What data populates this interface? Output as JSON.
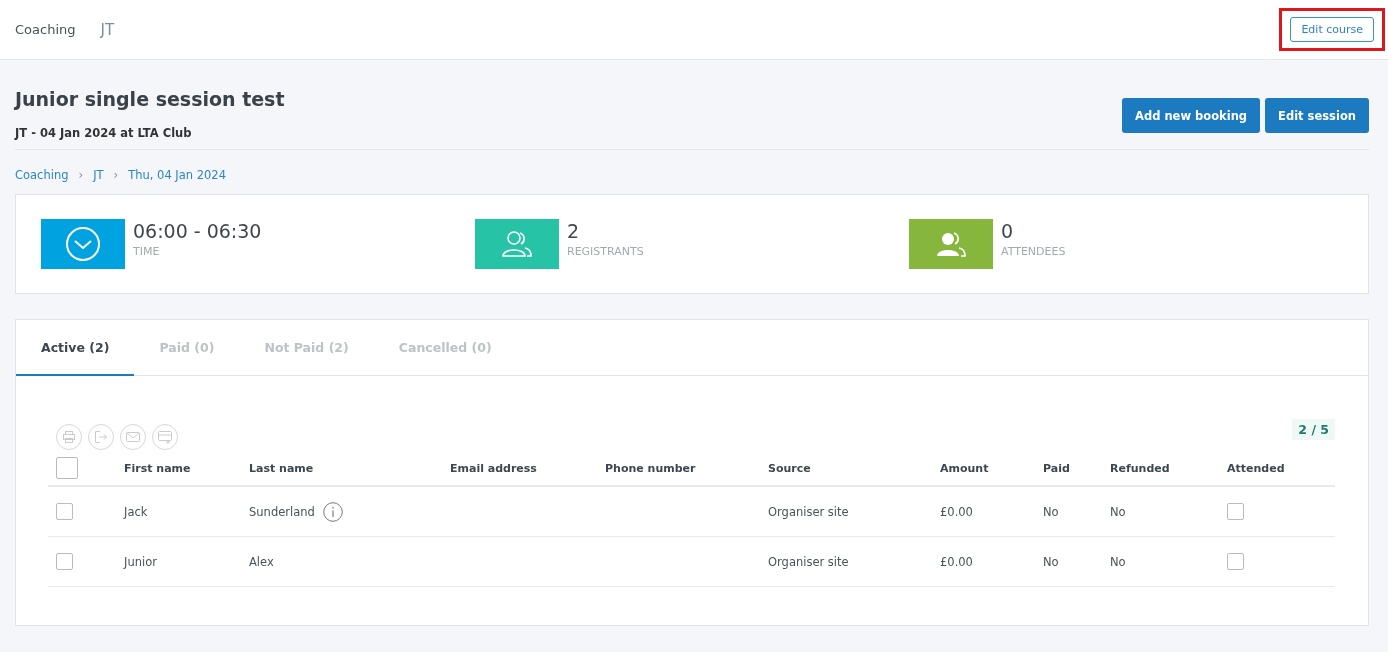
{
  "top_bar": {
    "items": [
      "Coaching",
      "JT"
    ],
    "edit_course_button": {
      "label": "Edit course",
      "highlighted": true
    }
  },
  "header": {
    "title": "Junior single session test",
    "subtitle": "JT - 04 Jan 2024 at LTA Club",
    "buttons": [
      "Add new booking",
      "Edit session"
    ]
  },
  "breadcrumb": [
    "Coaching",
    "JT",
    "Thu, 04 Jan 2024"
  ],
  "breadcrumb_separator": "›",
  "stats": [
    {
      "kind": "time",
      "value": "06:00 - 06:30",
      "label": "TIME",
      "color": "#00a3e0"
    },
    {
      "kind": "registrants",
      "value": "2",
      "label": "REGISTRANTS",
      "color": "#26c3a6"
    },
    {
      "kind": "attendees",
      "value": "0",
      "label": "ATTENDEES",
      "color": "#86b63b"
    }
  ],
  "tabs": [
    {
      "label": "Active (2)",
      "selected": true
    },
    {
      "label": "Paid (0)",
      "selected": false
    },
    {
      "label": "Not Paid (2)",
      "selected": false
    },
    {
      "label": "Cancelled (0)",
      "selected": false
    }
  ],
  "toolbar": {
    "actions": [
      {
        "kind": "print",
        "disabled": true
      },
      {
        "kind": "export",
        "disabled": true
      },
      {
        "kind": "email",
        "disabled": true
      },
      {
        "kind": "payment",
        "disabled": true
      }
    ],
    "count": "2 / 5"
  },
  "table": {
    "select_all_checked": false,
    "columns": [
      "First name",
      "Last name",
      "Email address",
      "Phone number",
      "Source",
      "Amount",
      "Paid",
      "Refunded",
      "Attended"
    ],
    "rows": [
      {
        "checked": false,
        "first_name": "Jack",
        "last_name": "Sunderland",
        "info": true,
        "email": "",
        "phone": "",
        "source": "Organiser site",
        "amount": "£0.00",
        "paid": "No",
        "refunded": "No",
        "attended": false
      },
      {
        "checked": false,
        "first_name": "Junior",
        "last_name": "Alex",
        "info": false,
        "email": "",
        "phone": "",
        "source": "Organiser site",
        "amount": "£0.00",
        "paid": "No",
        "refunded": "No",
        "attended": false
      }
    ]
  }
}
